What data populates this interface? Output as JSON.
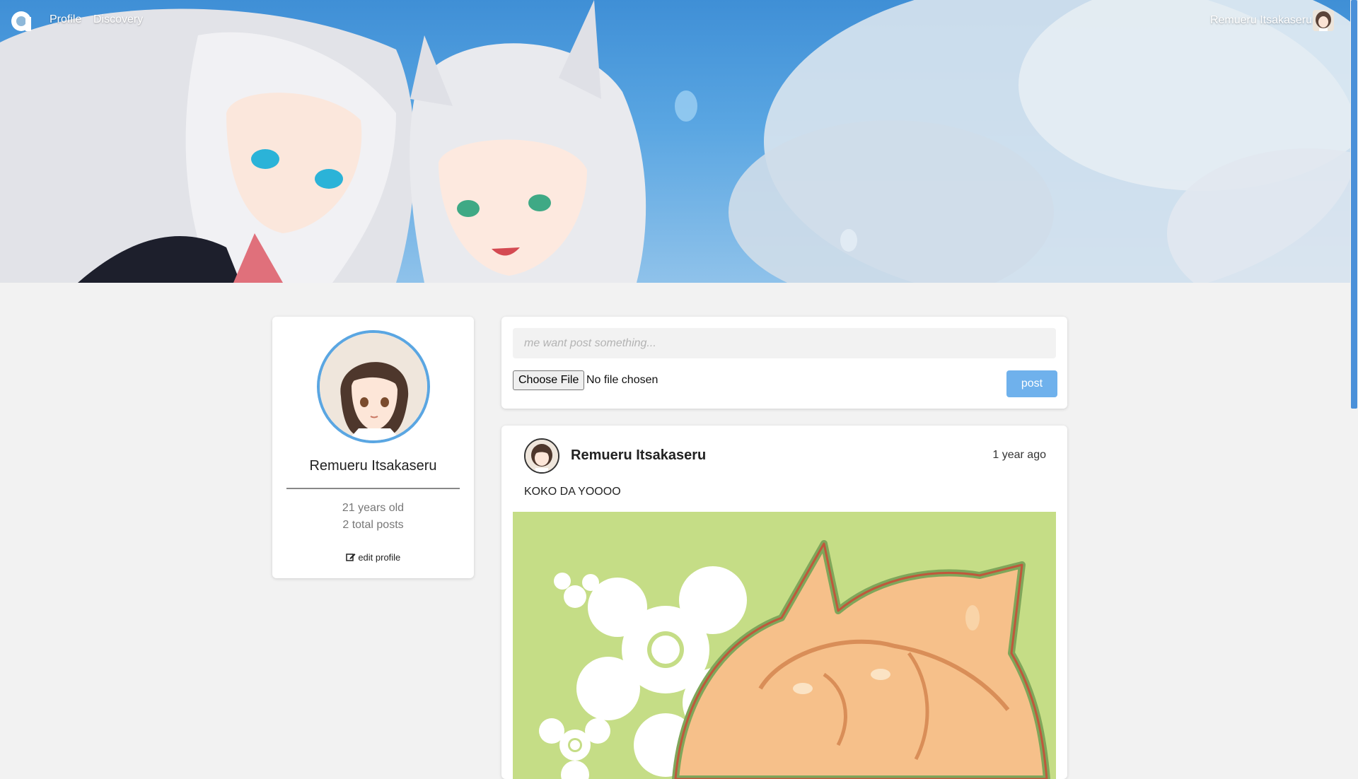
{
  "nav": {
    "links": [
      "Profile",
      "Discovery"
    ],
    "user_name": "Remueru Itsakaseru",
    "logo_icon": "logo-icon"
  },
  "profile": {
    "name": "Remueru Itsakaseru",
    "age": "21 years old",
    "posts": "2 total posts",
    "edit_label": "edit profile"
  },
  "composer": {
    "placeholder": "me want post something...",
    "file_button": "Choose File",
    "file_status": "No file chosen",
    "post_button": "post"
  },
  "post": {
    "author": "Remueru Itsakaseru",
    "time": "1 year ago",
    "text": "KOKO DA YOOOO"
  },
  "colors": {
    "accent": "#6fb1ec",
    "avatar_ring": "#5aa6e2",
    "background": "#f2f2f2",
    "post_image_bg": "#c5dd86"
  }
}
